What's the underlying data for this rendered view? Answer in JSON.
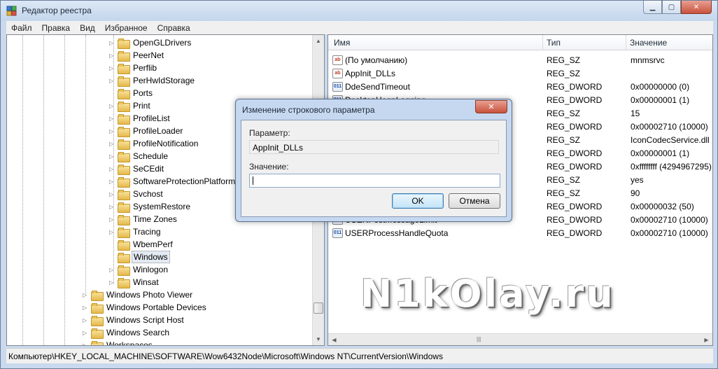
{
  "window": {
    "title": "Редактор реестра"
  },
  "menu": [
    "Файл",
    "Правка",
    "Вид",
    "Избранное",
    "Справка"
  ],
  "tree": {
    "items": [
      {
        "label": "OpenGLDrivers",
        "expander": "▷"
      },
      {
        "label": "PeerNet",
        "expander": "▷"
      },
      {
        "label": "Perflib",
        "expander": "▷"
      },
      {
        "label": "PerHwIdStorage",
        "expander": "▷"
      },
      {
        "label": "Ports",
        "expander": ""
      },
      {
        "label": "Print",
        "expander": "▷"
      },
      {
        "label": "ProfileList",
        "expander": "▷"
      },
      {
        "label": "ProfileLoader",
        "expander": "▷"
      },
      {
        "label": "ProfileNotification",
        "expander": "▷"
      },
      {
        "label": "Schedule",
        "expander": "▷"
      },
      {
        "label": "SeCEdit",
        "expander": "▷"
      },
      {
        "label": "SoftwareProtectionPlatform",
        "expander": "▷"
      },
      {
        "label": "Svchost",
        "expander": "▷"
      },
      {
        "label": "SystemRestore",
        "expander": "▷"
      },
      {
        "label": "Time Zones",
        "expander": "▷"
      },
      {
        "label": "Tracing",
        "expander": "▷"
      },
      {
        "label": "WbemPerf",
        "expander": ""
      },
      {
        "label": "Windows",
        "expander": "",
        "selected": true
      },
      {
        "label": "Winlogon",
        "expander": "▷"
      },
      {
        "label": "Winsat",
        "expander": "▷"
      }
    ],
    "parent_items": [
      {
        "label": "Windows Photo Viewer",
        "expander": "▷"
      },
      {
        "label": "Windows Portable Devices",
        "expander": "▷"
      },
      {
        "label": "Windows Script Host",
        "expander": "▷"
      },
      {
        "label": "Windows Search",
        "expander": "▷"
      },
      {
        "label": "Workspaces",
        "expander": "▷"
      }
    ]
  },
  "list": {
    "columns": {
      "name": "Имя",
      "type": "Тип",
      "value": "Значение"
    },
    "rows": [
      {
        "icon": "ab",
        "name": "(По умолчанию)",
        "type": "REG_SZ",
        "value": "mnmsrvc"
      },
      {
        "icon": "ab",
        "name": "AppInit_DLLs",
        "type": "REG_SZ",
        "value": ""
      },
      {
        "icon": "bin",
        "name": "DdeSendTimeout",
        "type": "REG_DWORD",
        "value": "0x00000000 (0)"
      },
      {
        "icon": "bin",
        "name": "DesktopHeapLogging",
        "type": "REG_DWORD",
        "value": "0x00000001 (1)"
      },
      {
        "icon": "ab",
        "name": "",
        "type": "REG_SZ",
        "value": "15"
      },
      {
        "icon": "bin",
        "name": "",
        "type": "REG_DWORD",
        "value": "0x00002710 (10000)"
      },
      {
        "icon": "ab",
        "name": "",
        "type": "REG_SZ",
        "value": "IconCodecService.dll"
      },
      {
        "icon": "bin",
        "name": "",
        "type": "REG_DWORD",
        "value": "0x00000001 (1)"
      },
      {
        "icon": "bin",
        "name": "",
        "type": "REG_DWORD",
        "value": "0xffffffff (4294967295)"
      },
      {
        "icon": "ab",
        "name": "",
        "type": "REG_SZ",
        "value": "yes"
      },
      {
        "icon": "ab",
        "name": "",
        "type": "REG_SZ",
        "value": "90"
      },
      {
        "icon": "bin",
        "name": "",
        "type": "REG_DWORD",
        "value": "0x00000032 (50)"
      },
      {
        "icon": "bin",
        "name": "USERPostMessageLimit",
        "type": "REG_DWORD",
        "value": "0x00002710 (10000)"
      },
      {
        "icon": "bin",
        "name": "USERProcessHandleQuota",
        "type": "REG_DWORD",
        "value": "0x00002710 (10000)"
      }
    ]
  },
  "status": {
    "path": "Компьютер\\HKEY_LOCAL_MACHINE\\SOFTWARE\\Wow6432Node\\Microsoft\\Windows NT\\CurrentVersion\\Windows"
  },
  "dialog": {
    "title": "Изменение строкового параметра",
    "param_label": "Параметр:",
    "param_value": "AppInit_DLLs",
    "value_label": "Значение:",
    "value_input": "",
    "ok_label": "OK",
    "cancel_label": "Отмена"
  },
  "watermark": "N1kOlay.ru",
  "icons": {
    "window": "regedit-icon",
    "string_value": "ab-icon",
    "binary_value": "binary-icon",
    "folder": "folder-icon"
  },
  "colors": {
    "title_gradient_top": "#dce8f6",
    "close_button": "#c9523c",
    "selection": "#e4eaf3"
  }
}
